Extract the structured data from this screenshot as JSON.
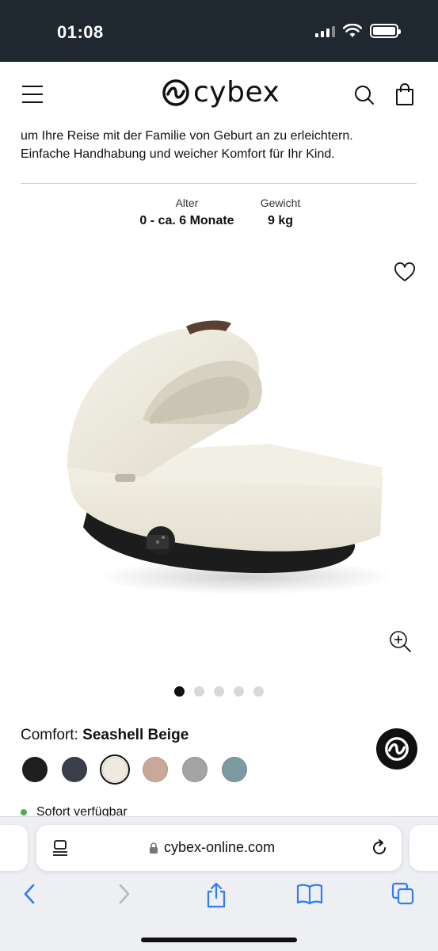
{
  "status_bar": {
    "time": "01:08"
  },
  "header": {
    "logo_text": "cybex"
  },
  "intro": {
    "line1": "um Ihre Reise mit der Familie von Geburt an zu erleichtern.",
    "line2": "Einfache Handhabung und weicher Komfort für Ihr Kind."
  },
  "specs": {
    "age_label": "Alter",
    "age_value": "0 - ca. 6 Monate",
    "weight_label": "Gewicht",
    "weight_value": "9 kg"
  },
  "gallery": {
    "total_images": 5,
    "active_index": 0
  },
  "color": {
    "label": "Comfort:",
    "selected_name": "Seashell Beige",
    "swatches": [
      "#1e1e1e",
      "#3a3f4b",
      "#efeae0",
      "#c9a898",
      "#a6a4a3",
      "#7d9aa3"
    ],
    "selected_index": 2
  },
  "availability": {
    "text": "Sofort verfügbar",
    "status_color": "#4caf50"
  },
  "browser": {
    "url": "cybex-online.com"
  },
  "icons": {
    "menu": "hamburger-menu-icon",
    "search": "search-icon",
    "bag": "shopping-bag-icon",
    "wishlist": "heart-icon",
    "zoom": "zoom-in-icon",
    "badge": "cybex-logo-icon",
    "lock": "lock-icon",
    "reader": "reader-icon",
    "reload": "reload-icon",
    "back": "back-icon",
    "forward": "forward-icon",
    "share": "share-icon",
    "bookmarks": "bookmarks-icon",
    "tabs": "tabs-icon"
  }
}
